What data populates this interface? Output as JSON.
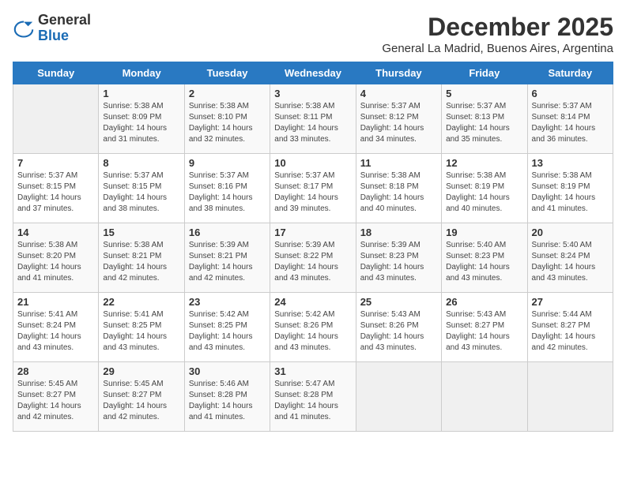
{
  "logo": {
    "general": "General",
    "blue": "Blue"
  },
  "header": {
    "month_year": "December 2025",
    "location": "General La Madrid, Buenos Aires, Argentina"
  },
  "weekdays": [
    "Sunday",
    "Monday",
    "Tuesday",
    "Wednesday",
    "Thursday",
    "Friday",
    "Saturday"
  ],
  "weeks": [
    [
      {
        "day": "",
        "sunrise": "",
        "sunset": "",
        "daylight": ""
      },
      {
        "day": "1",
        "sunrise": "Sunrise: 5:38 AM",
        "sunset": "Sunset: 8:09 PM",
        "daylight": "Daylight: 14 hours and 31 minutes."
      },
      {
        "day": "2",
        "sunrise": "Sunrise: 5:38 AM",
        "sunset": "Sunset: 8:10 PM",
        "daylight": "Daylight: 14 hours and 32 minutes."
      },
      {
        "day": "3",
        "sunrise": "Sunrise: 5:38 AM",
        "sunset": "Sunset: 8:11 PM",
        "daylight": "Daylight: 14 hours and 33 minutes."
      },
      {
        "day": "4",
        "sunrise": "Sunrise: 5:37 AM",
        "sunset": "Sunset: 8:12 PM",
        "daylight": "Daylight: 14 hours and 34 minutes."
      },
      {
        "day": "5",
        "sunrise": "Sunrise: 5:37 AM",
        "sunset": "Sunset: 8:13 PM",
        "daylight": "Daylight: 14 hours and 35 minutes."
      },
      {
        "day": "6",
        "sunrise": "Sunrise: 5:37 AM",
        "sunset": "Sunset: 8:14 PM",
        "daylight": "Daylight: 14 hours and 36 minutes."
      }
    ],
    [
      {
        "day": "7",
        "sunrise": "Sunrise: 5:37 AM",
        "sunset": "Sunset: 8:15 PM",
        "daylight": "Daylight: 14 hours and 37 minutes."
      },
      {
        "day": "8",
        "sunrise": "Sunrise: 5:37 AM",
        "sunset": "Sunset: 8:15 PM",
        "daylight": "Daylight: 14 hours and 38 minutes."
      },
      {
        "day": "9",
        "sunrise": "Sunrise: 5:37 AM",
        "sunset": "Sunset: 8:16 PM",
        "daylight": "Daylight: 14 hours and 38 minutes."
      },
      {
        "day": "10",
        "sunrise": "Sunrise: 5:37 AM",
        "sunset": "Sunset: 8:17 PM",
        "daylight": "Daylight: 14 hours and 39 minutes."
      },
      {
        "day": "11",
        "sunrise": "Sunrise: 5:38 AM",
        "sunset": "Sunset: 8:18 PM",
        "daylight": "Daylight: 14 hours and 40 minutes."
      },
      {
        "day": "12",
        "sunrise": "Sunrise: 5:38 AM",
        "sunset": "Sunset: 8:19 PM",
        "daylight": "Daylight: 14 hours and 40 minutes."
      },
      {
        "day": "13",
        "sunrise": "Sunrise: 5:38 AM",
        "sunset": "Sunset: 8:19 PM",
        "daylight": "Daylight: 14 hours and 41 minutes."
      }
    ],
    [
      {
        "day": "14",
        "sunrise": "Sunrise: 5:38 AM",
        "sunset": "Sunset: 8:20 PM",
        "daylight": "Daylight: 14 hours and 41 minutes."
      },
      {
        "day": "15",
        "sunrise": "Sunrise: 5:38 AM",
        "sunset": "Sunset: 8:21 PM",
        "daylight": "Daylight: 14 hours and 42 minutes."
      },
      {
        "day": "16",
        "sunrise": "Sunrise: 5:39 AM",
        "sunset": "Sunset: 8:21 PM",
        "daylight": "Daylight: 14 hours and 42 minutes."
      },
      {
        "day": "17",
        "sunrise": "Sunrise: 5:39 AM",
        "sunset": "Sunset: 8:22 PM",
        "daylight": "Daylight: 14 hours and 43 minutes."
      },
      {
        "day": "18",
        "sunrise": "Sunrise: 5:39 AM",
        "sunset": "Sunset: 8:23 PM",
        "daylight": "Daylight: 14 hours and 43 minutes."
      },
      {
        "day": "19",
        "sunrise": "Sunrise: 5:40 AM",
        "sunset": "Sunset: 8:23 PM",
        "daylight": "Daylight: 14 hours and 43 minutes."
      },
      {
        "day": "20",
        "sunrise": "Sunrise: 5:40 AM",
        "sunset": "Sunset: 8:24 PM",
        "daylight": "Daylight: 14 hours and 43 minutes."
      }
    ],
    [
      {
        "day": "21",
        "sunrise": "Sunrise: 5:41 AM",
        "sunset": "Sunset: 8:24 PM",
        "daylight": "Daylight: 14 hours and 43 minutes."
      },
      {
        "day": "22",
        "sunrise": "Sunrise: 5:41 AM",
        "sunset": "Sunset: 8:25 PM",
        "daylight": "Daylight: 14 hours and 43 minutes."
      },
      {
        "day": "23",
        "sunrise": "Sunrise: 5:42 AM",
        "sunset": "Sunset: 8:25 PM",
        "daylight": "Daylight: 14 hours and 43 minutes."
      },
      {
        "day": "24",
        "sunrise": "Sunrise: 5:42 AM",
        "sunset": "Sunset: 8:26 PM",
        "daylight": "Daylight: 14 hours and 43 minutes."
      },
      {
        "day": "25",
        "sunrise": "Sunrise: 5:43 AM",
        "sunset": "Sunset: 8:26 PM",
        "daylight": "Daylight: 14 hours and 43 minutes."
      },
      {
        "day": "26",
        "sunrise": "Sunrise: 5:43 AM",
        "sunset": "Sunset: 8:27 PM",
        "daylight": "Daylight: 14 hours and 43 minutes."
      },
      {
        "day": "27",
        "sunrise": "Sunrise: 5:44 AM",
        "sunset": "Sunset: 8:27 PM",
        "daylight": "Daylight: 14 hours and 42 minutes."
      }
    ],
    [
      {
        "day": "28",
        "sunrise": "Sunrise: 5:45 AM",
        "sunset": "Sunset: 8:27 PM",
        "daylight": "Daylight: 14 hours and 42 minutes."
      },
      {
        "day": "29",
        "sunrise": "Sunrise: 5:45 AM",
        "sunset": "Sunset: 8:27 PM",
        "daylight": "Daylight: 14 hours and 42 minutes."
      },
      {
        "day": "30",
        "sunrise": "Sunrise: 5:46 AM",
        "sunset": "Sunset: 8:28 PM",
        "daylight": "Daylight: 14 hours and 41 minutes."
      },
      {
        "day": "31",
        "sunrise": "Sunrise: 5:47 AM",
        "sunset": "Sunset: 8:28 PM",
        "daylight": "Daylight: 14 hours and 41 minutes."
      },
      {
        "day": "",
        "sunrise": "",
        "sunset": "",
        "daylight": ""
      },
      {
        "day": "",
        "sunrise": "",
        "sunset": "",
        "daylight": ""
      },
      {
        "day": "",
        "sunrise": "",
        "sunset": "",
        "daylight": ""
      }
    ]
  ]
}
